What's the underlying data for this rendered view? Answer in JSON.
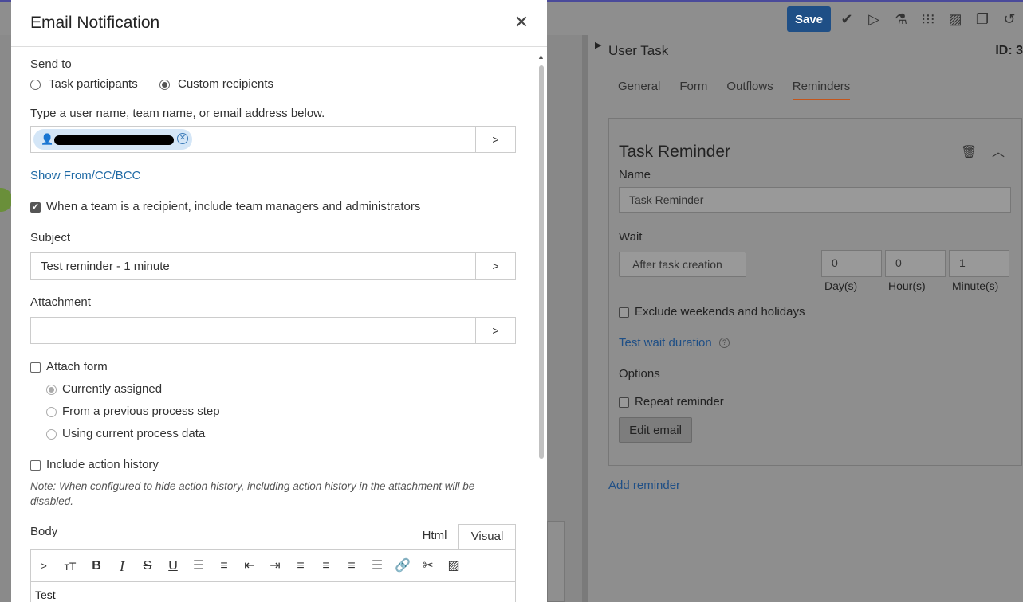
{
  "app": {
    "toolbar": {
      "save_label": "Save"
    },
    "panel": {
      "title": "User Task",
      "id": "ID: 3",
      "tabs": [
        "General",
        "Form",
        "Outflows",
        "Reminders"
      ],
      "active_tab": "Reminders",
      "card": {
        "title": "Task Reminder",
        "name_label": "Name",
        "name_value": "Task Reminder",
        "wait_label": "Wait",
        "wait_select": "After task creation",
        "days_value": "0",
        "hours_value": "0",
        "minutes_value": "1",
        "days_label": "Day(s)",
        "hours_label": "Hour(s)",
        "minutes_label": "Minute(s)",
        "exclude_label": "Exclude weekends and holidays",
        "test_wait_link": "Test wait duration",
        "options_label": "Options",
        "repeat_label": "Repeat reminder",
        "edit_email_label": "Edit email"
      },
      "add_reminder": "Add reminder"
    }
  },
  "modal": {
    "title": "Email Notification",
    "send_to_label": "Send to",
    "radio_task_participants": "Task participants",
    "radio_custom_recipients": "Custom recipients",
    "recipients_hint": "Type a user name, team name, or email address below.",
    "go_label": ">",
    "show_from_cc_bcc": "Show From/CC/BCC",
    "team_checkbox_label": "When a team is a recipient, include team managers and administrators",
    "subject_label": "Subject",
    "subject_value": "Test reminder - 1 minute",
    "attachment_label": "Attachment",
    "attach_form_label": "Attach form",
    "attach_options": [
      "Currently assigned",
      "From a previous process step",
      "Using current process data"
    ],
    "include_history_label": "Include action history",
    "note": "Note: When configured to hide action history, including action history in the attachment will be disabled.",
    "body_label": "Body",
    "editor_tab_html": "Html",
    "editor_tab_visual": "Visual",
    "toolbar_first": ">",
    "body_text": "Test"
  }
}
